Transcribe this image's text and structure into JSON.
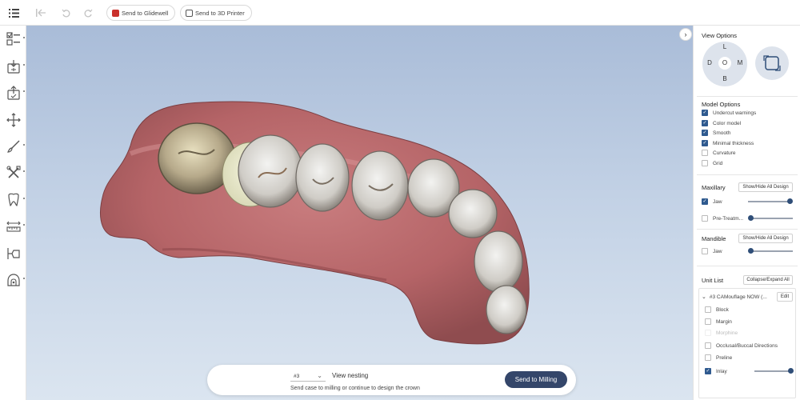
{
  "toolbar": {
    "menu_icon": "list-icon",
    "first_icon": "first-page-icon",
    "undo_icon": "undo-icon",
    "redo_icon": "redo-icon",
    "send_glidewell_label": "Send to Glidewell",
    "send_printer_label": "Send to 3D Printer"
  },
  "left_tools": [
    "checklist-icon",
    "import-icon",
    "export-icon",
    "move-icon",
    "brush-icon",
    "tools-icon",
    "tooth-icon",
    "measure-icon",
    "margin-icon",
    "scan-icon"
  ],
  "view_options": {
    "title": "View Options",
    "compass": {
      "top": "L",
      "left": "D",
      "center": "O",
      "right": "M",
      "bottom": "B"
    }
  },
  "model_options": {
    "title": "Model Options",
    "items": [
      {
        "label": "Undercut warnings",
        "checked": true
      },
      {
        "label": "Color model",
        "checked": true
      },
      {
        "label": "Smooth",
        "checked": true
      },
      {
        "label": "Minimal thickness",
        "checked": true
      },
      {
        "label": "Curvature",
        "checked": false
      },
      {
        "label": "Grid",
        "checked": false
      }
    ]
  },
  "maxillary": {
    "title": "Maxillary",
    "button": "Show/Hide All Design",
    "jaw_label": "Jaw",
    "jaw_checked": true,
    "jaw_level": 1.0,
    "pretreat_label": "Pre-Treatm...",
    "pretreat_checked": false,
    "pretreat_level": 0.0
  },
  "mandible": {
    "title": "Mandible",
    "button": "Show/Hide All Design",
    "jaw_label": "Jaw",
    "jaw_checked": false,
    "jaw_level": 0.0
  },
  "unit_list": {
    "title": "Unit List",
    "button": "Collapse/Expand All",
    "unit_label": "#3 CAMouflage NOW (...",
    "edit_label": "Edit",
    "items": [
      {
        "label": "Block",
        "checked": false
      },
      {
        "label": "Margin",
        "checked": false
      },
      {
        "label": "Morphine",
        "checked": false,
        "disabled": true
      },
      {
        "label": "Occlusal/Buccal Directions",
        "checked": false
      },
      {
        "label": "Preline",
        "checked": false
      },
      {
        "label": "Inlay",
        "checked": true
      }
    ],
    "inlay_level": 1.0
  },
  "bottom": {
    "unit_value": "#3",
    "view_nesting": "View nesting",
    "hint": "Send case to milling or continue to design the crown",
    "milling_button": "Send to Milling"
  },
  "colors": {
    "accent": "#2f5a8f",
    "primary_button": "#34466a",
    "viewport_top": "#a9bcd8",
    "viewport_bottom": "#dbe5f0",
    "gum": "#b86a6e"
  }
}
